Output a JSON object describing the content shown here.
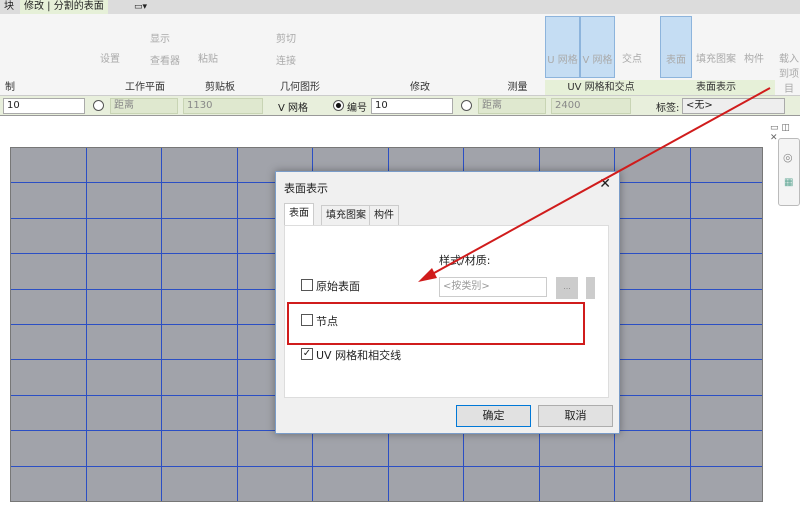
{
  "tabs": [
    {
      "label": "块"
    },
    {
      "label": "修改 | 分割的表面"
    }
  ],
  "ribbon": {
    "panels": [
      "制",
      "工作平面",
      "剪贴板",
      "几何图形",
      "修改",
      "测量",
      "UV 网格和交点",
      "表面表示"
    ],
    "workplane": {
      "set": "设置",
      "show": "显示",
      "viewer": "查看器"
    },
    "clipboard": {
      "paste": "粘贴"
    },
    "geometry": {
      "cut": "剪切",
      "join": "连接"
    },
    "uv": {
      "u_grid": "U 网格",
      "v_grid": "V 网格",
      "intersect": "交点"
    },
    "surface": {
      "surface": "表面",
      "fill_pattern": "填充图案",
      "component": "构件"
    },
    "load": "载入到项目"
  },
  "options": {
    "field1": "10",
    "distance1": "距离",
    "value1": "1130",
    "v_grid": "V 网格",
    "number": "编号",
    "field2": "10",
    "distance2": "距离",
    "value2": "2400",
    "tag_label": "标签:",
    "tag_value": "<无>"
  },
  "dialog": {
    "title": "表面表示",
    "tabs": [
      "表面",
      "填充图案",
      "构件"
    ],
    "style_label": "样式/材质:",
    "original_surface": {
      "label": "原始表面",
      "checked": false
    },
    "material_placeholder": "<按类别>",
    "browse": "...",
    "nodes": {
      "label": "节点",
      "checked": false
    },
    "uv_grid": {
      "label": "UV 网格和相交线",
      "checked": true
    },
    "ok": "确定",
    "cancel": "取消"
  },
  "colors": {
    "grid_line": "#2b4fc4",
    "canvas": "#a1a3aa",
    "annotation": "#d01c1c"
  }
}
